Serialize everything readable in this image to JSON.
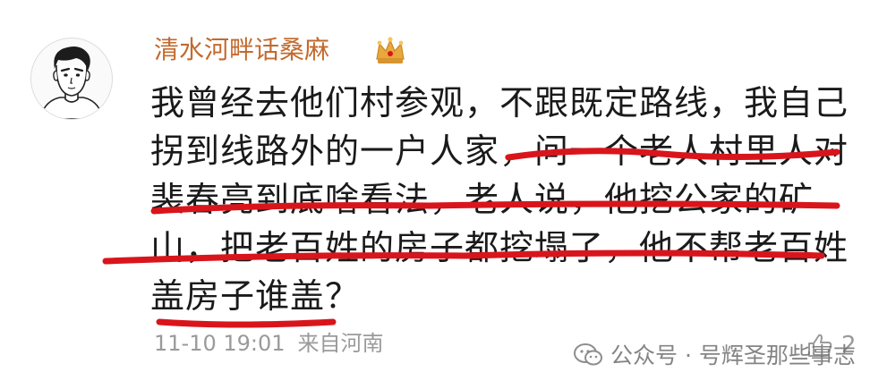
{
  "comment": {
    "username": "清水河畔话桑麻",
    "badge_icon": "crown-icon",
    "avatar_icon": "cartoon-man-avatar",
    "lines": [
      "我曾经去他们村参观，不跟既定路线，我自己",
      "拐到线路外的一户人家，问一个老人村里人对",
      "裴春亮到底啥看法，老人说，他挖公家的矿",
      "山，把老百姓的房子都挖塌了，他不帮老百姓",
      "盖房子谁盖？"
    ],
    "time": "11-10 19:01",
    "location": "来自河南",
    "like_icon": "thumbs-up-icon",
    "like_count": "2"
  },
  "watermark": {
    "icon": "wechat-official-account-icon",
    "text": "公众号 · 号辉圣那些事志"
  },
  "colors": {
    "username": "#c26a2e",
    "body_text": "#1a1a1a",
    "meta_text": "#9a9a9a",
    "underline": "#d9151c",
    "crown": "#e3a23a"
  }
}
